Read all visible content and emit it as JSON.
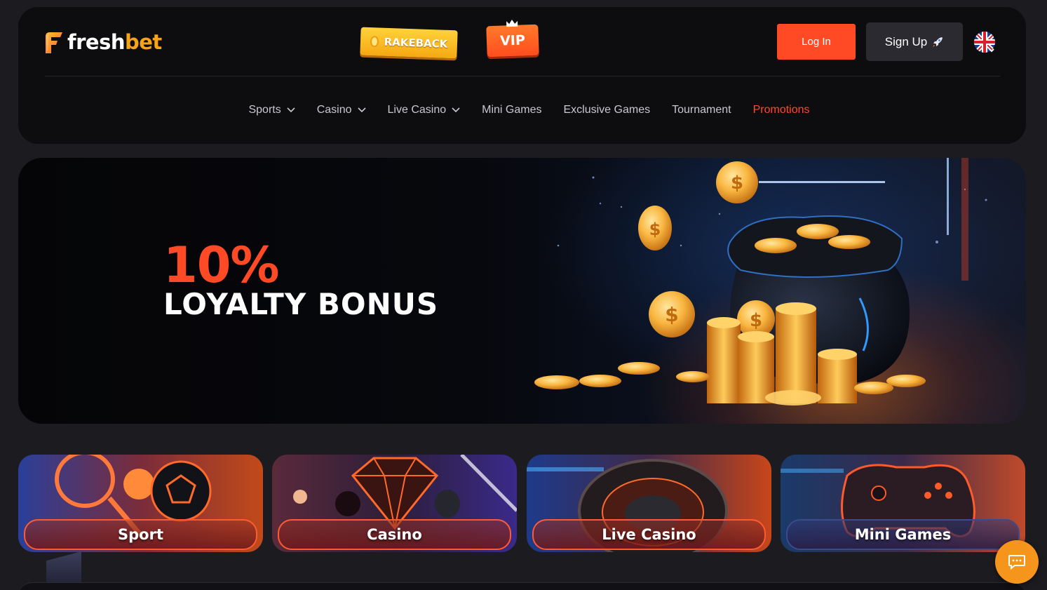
{
  "header": {
    "logo": {
      "text_main": "fresh",
      "text_accent": "bet"
    },
    "rakeback_label": "RAKEBACK",
    "vip_label": "VIP",
    "login_label": "Log In",
    "signup_label": "Sign Up",
    "language_icon": "uk-flag-icon"
  },
  "nav": {
    "items": [
      {
        "label": "Sports",
        "dropdown": true
      },
      {
        "label": "Casino",
        "dropdown": true
      },
      {
        "label": "Live Casino",
        "dropdown": true
      },
      {
        "label": "Mini Games",
        "dropdown": false
      },
      {
        "label": "Exclusive Games",
        "dropdown": false
      },
      {
        "label": "Tournament",
        "dropdown": false
      },
      {
        "label": "Promotions",
        "dropdown": false,
        "active": true
      }
    ]
  },
  "hero": {
    "headline_pct": "10%",
    "headline_text": "LOYALTY BONUS"
  },
  "categories": [
    {
      "label": "Sport"
    },
    {
      "label": "Casino"
    },
    {
      "label": "Live Casino"
    },
    {
      "label": "Mini Games"
    }
  ],
  "colors": {
    "accent": "#ff4a25",
    "gold": "#f6a21a",
    "background": "#1c1b1f",
    "panel": "#0d0d0f"
  },
  "chat_icon": "chat-bubble-icon"
}
